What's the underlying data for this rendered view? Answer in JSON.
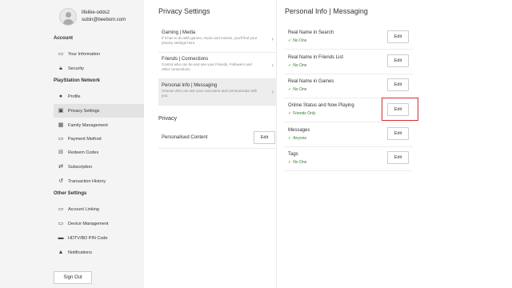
{
  "profile": {
    "username": "lifelike-odds2",
    "email": "subin@beebom.com"
  },
  "sidebar": {
    "account_heading": "Account",
    "account_items": [
      {
        "label": "Your Information",
        "icon": "id-card-icon"
      },
      {
        "label": "Security",
        "icon": "lock-icon"
      }
    ],
    "psn_heading": "PlayStation Network",
    "psn_items": [
      {
        "label": "Profile",
        "icon": "profile-icon"
      },
      {
        "label": "Privacy Settings",
        "icon": "privacy-icon"
      },
      {
        "label": "Family Management",
        "icon": "family-icon"
      },
      {
        "label": "Payment Method",
        "icon": "card-icon"
      },
      {
        "label": "Redeem Codes",
        "icon": "redeem-icon"
      },
      {
        "label": "Subscription",
        "icon": "subscription-icon"
      },
      {
        "label": "Transaction History",
        "icon": "history-icon"
      }
    ],
    "other_heading": "Other Settings",
    "other_items": [
      {
        "label": "Account Linking",
        "icon": "link-icon"
      },
      {
        "label": "Device Management",
        "icon": "device-icon"
      },
      {
        "label": "HDTV/BD PIN Code",
        "icon": "tv-icon"
      },
      {
        "label": "Notifications",
        "icon": "bell-icon"
      }
    ],
    "sign_out": "Sign Out"
  },
  "privacy": {
    "title": "Privacy Settings",
    "items": [
      {
        "title": "Gaming | Media",
        "desc": "If it has to do with games, music and movies, you'll find your privacy settings here."
      },
      {
        "title": "Friends | Connections",
        "desc": "Control who can be and see your Friends, Followers and other connections."
      },
      {
        "title": "Personal Info | Messaging",
        "desc": "Choose who can see your real name and communicate with you."
      }
    ],
    "privacy_heading": "Privacy",
    "personalised_label": "Personalised Content",
    "edit": "Edit"
  },
  "personal": {
    "title": "Personal Info | Messaging",
    "settings": [
      {
        "name": "Real Name in Search",
        "value": "No One"
      },
      {
        "name": "Real Name in Friends List",
        "value": "No One"
      },
      {
        "name": "Real Name in Games",
        "value": "No One"
      },
      {
        "name": "Online Status and Now Playing",
        "value": "Friends Only"
      },
      {
        "name": "Messages",
        "value": "Anyone"
      },
      {
        "name": "Tags",
        "value": "No One"
      }
    ],
    "edit": "Edit"
  },
  "colors": {
    "highlight": "#d32f2f",
    "value_green": "#2e7d32",
    "active_item": "#e3e3e3"
  }
}
